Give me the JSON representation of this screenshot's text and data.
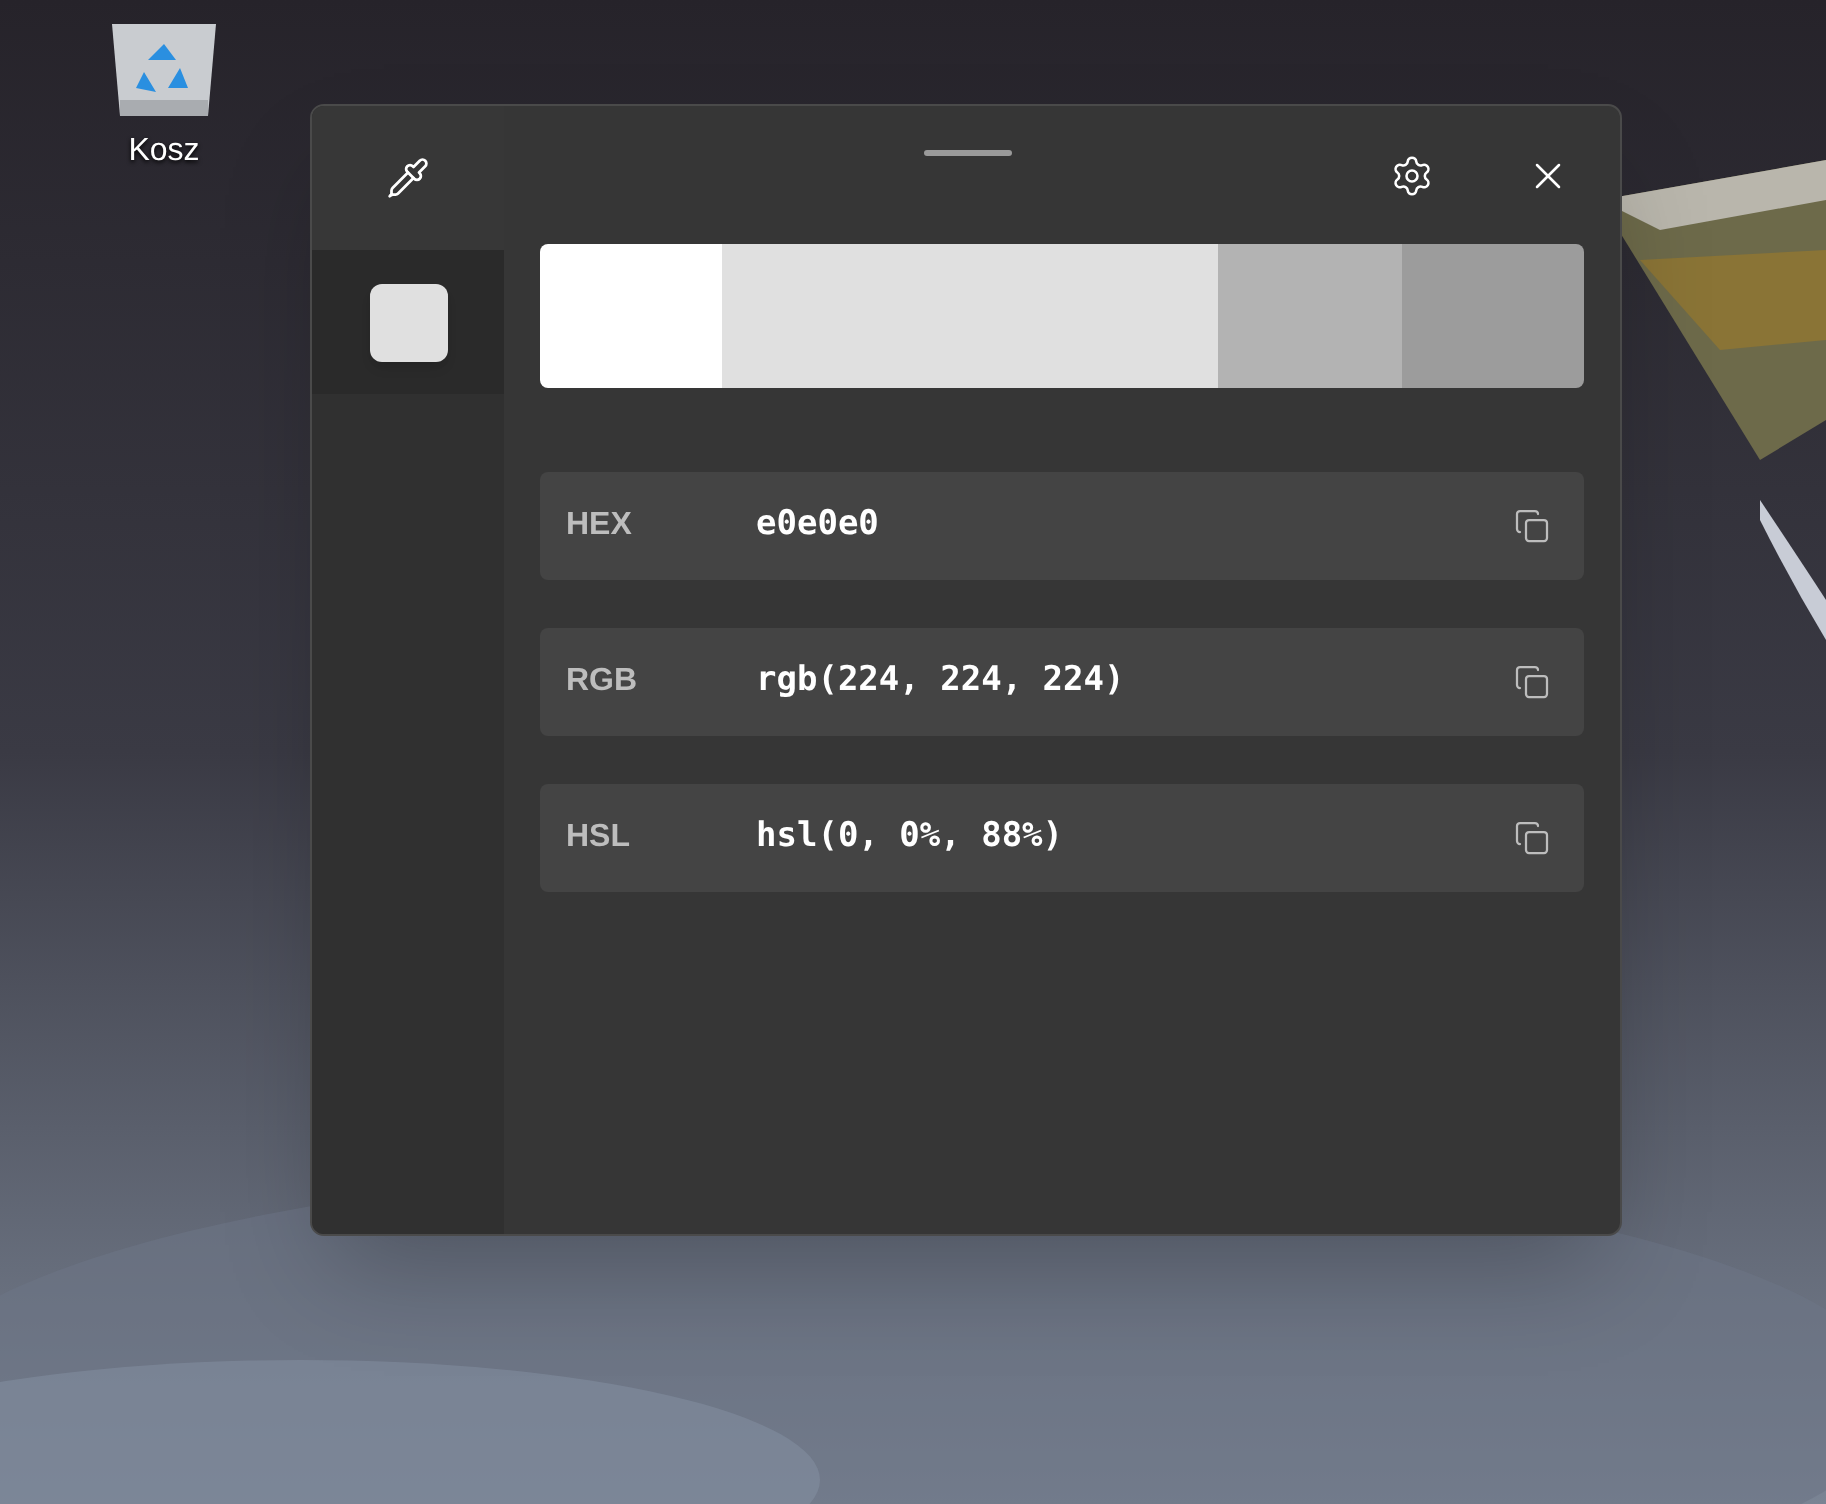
{
  "desktop_icons": [
    {
      "label": "Kosz"
    }
  ],
  "window": {
    "history": [
      {
        "color": "#e0e0e0",
        "selected": true
      }
    ],
    "shades": [
      {
        "color": "#ffffff",
        "selected": false
      },
      {
        "color": "#e0e0e0",
        "selected": true
      },
      {
        "color": "#b3b3b3",
        "selected": false
      },
      {
        "color": "#9c9c9c",
        "selected": false
      }
    ],
    "formats": [
      {
        "label": "HEX",
        "value": "e0e0e0"
      },
      {
        "label": "RGB",
        "value": "rgb(224, 224, 224)"
      },
      {
        "label": "HSL",
        "value": "hsl(0, 0%, 88%)"
      }
    ]
  }
}
